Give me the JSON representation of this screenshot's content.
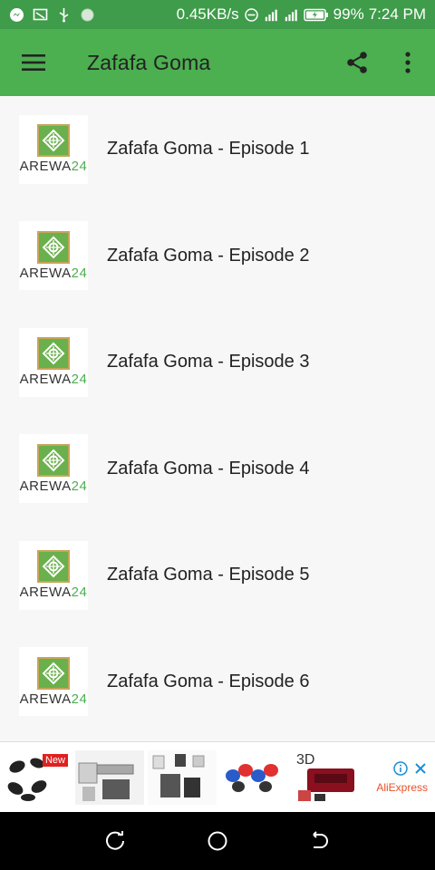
{
  "status_bar": {
    "speed": "0.45KB/s",
    "battery": "99%",
    "time": "7:24 PM",
    "icons": [
      "messenger-icon",
      "cast-icon",
      "usb-icon",
      "dot-icon",
      "dnd-icon",
      "signal-hplus-icon",
      "signal-icon",
      "battery-charging-icon"
    ]
  },
  "app_bar": {
    "title": "Zafafa Goma",
    "background": "#4caf50",
    "icons": [
      "menu-icon",
      "share-icon",
      "more-vert-icon"
    ]
  },
  "episodes": [
    {
      "title": "Zafafa Goma - Episode 1",
      "thumb_brand": "AREWA",
      "thumb_num": "24"
    },
    {
      "title": "Zafafa Goma - Episode 2",
      "thumb_brand": "AREWA",
      "thumb_num": "24"
    },
    {
      "title": "Zafafa Goma - Episode 3",
      "thumb_brand": "AREWA",
      "thumb_num": "24"
    },
    {
      "title": "Zafafa Goma - Episode 4",
      "thumb_brand": "AREWA",
      "thumb_num": "24"
    },
    {
      "title": "Zafafa Goma - Episode 5",
      "thumb_brand": "AREWA",
      "thumb_num": "24"
    },
    {
      "title": "Zafafa Goma - Episode 6",
      "thumb_brand": "AREWA",
      "thumb_num": "24"
    }
  ],
  "ad": {
    "new_badge": "New",
    "tile_3d_label": "3D",
    "brand": "AliExpress"
  },
  "nav_bar": {
    "icons": [
      "recents-icon",
      "home-icon",
      "back-icon"
    ]
  }
}
